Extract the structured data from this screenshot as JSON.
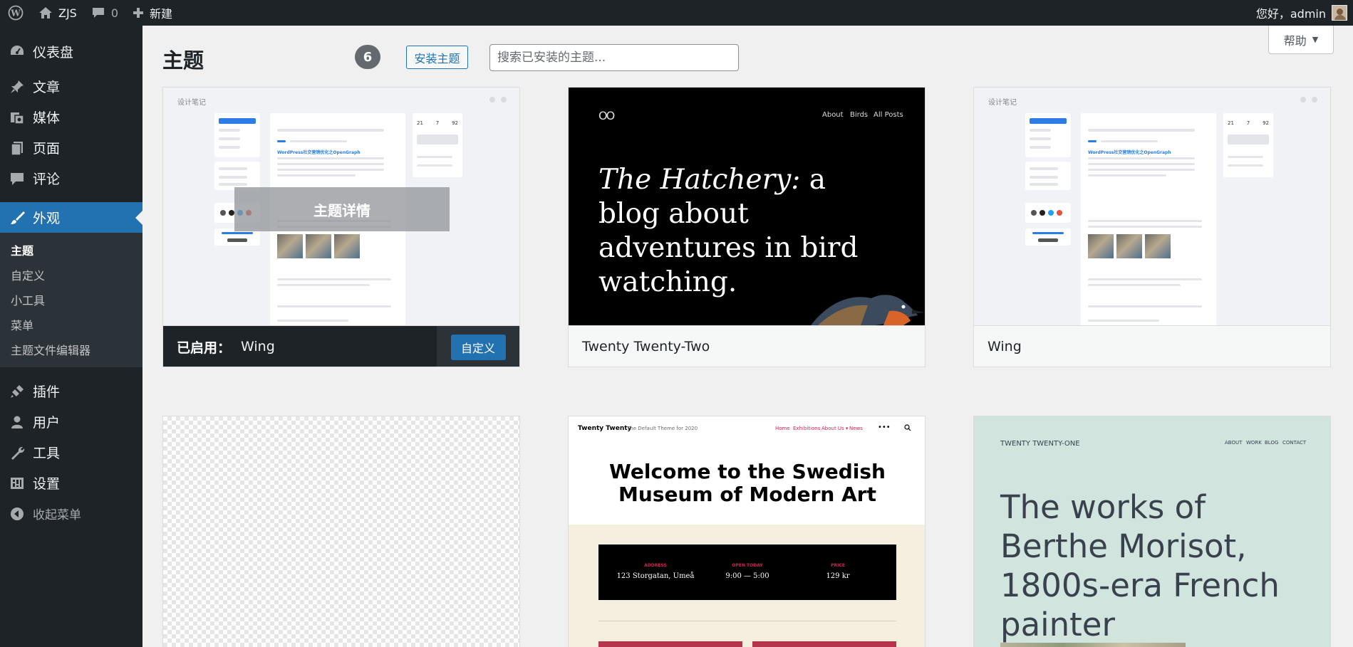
{
  "admin_bar": {
    "site_name": "ZJS",
    "comments_count": "0",
    "new_label": "新建",
    "greeting": "您好，admin"
  },
  "sidebar": {
    "items": [
      {
        "label": "仪表盘",
        "icon": "dashboard-icon"
      },
      {
        "label": "文章",
        "icon": "pin-icon"
      },
      {
        "label": "媒体",
        "icon": "media-icon"
      },
      {
        "label": "页面",
        "icon": "page-icon"
      },
      {
        "label": "评论",
        "icon": "comment-icon"
      },
      {
        "label": "外观",
        "icon": "paintbrush-icon"
      },
      {
        "label": "插件",
        "icon": "plugin-icon"
      },
      {
        "label": "用户",
        "icon": "user-icon"
      },
      {
        "label": "工具",
        "icon": "wrench-icon"
      },
      {
        "label": "设置",
        "icon": "settings-icon"
      }
    ],
    "submenu": [
      "主题",
      "自定义",
      "小工具",
      "菜单",
      "主题文件编辑器"
    ],
    "collapse_label": "收起菜单"
  },
  "main": {
    "title": "主题",
    "count": "6",
    "install_label": "安装主题",
    "search_placeholder": "搜索已安装的主题...",
    "help_label": "帮助"
  },
  "themes": {
    "active": {
      "active_label": "已启用：",
      "name": "Wing",
      "customize_label": "自定义",
      "details_overlay": "主题详情",
      "preview": {
        "site_name": "设计笔记",
        "post_title": "WordPress社交营销优化之OpenGraph",
        "stats": [
          "21",
          "7",
          "92"
        ]
      }
    },
    "tt2": {
      "name": "Twenty Twenty-Two",
      "preview": {
        "logo": "OO",
        "nav": [
          "About",
          "Birds",
          "All Posts"
        ],
        "heading_italic": "The Hatchery:",
        "heading_rest": " a blog about adventures in bird watching."
      }
    },
    "wing": {
      "name": "Wing",
      "preview": {
        "site_name": "设计笔记",
        "post_title": "WordPress社交营销优化之OpenGraph",
        "stats": [
          "21",
          "7",
          "92"
        ]
      }
    },
    "t20": {
      "preview": {
        "site_name": "Twenty Twenty",
        "tagline": "The Default Theme for 2020",
        "nav": [
          "Home",
          "Exhibitions",
          "About Us ▾",
          "News"
        ],
        "title": "Welcome to the Swedish Museum of Modern Art",
        "info": [
          {
            "label": "ADDRESS",
            "value": "123 Storgatan, Umeå"
          },
          {
            "label": "OPEN TODAY",
            "value": "9:00 — 5:00"
          },
          {
            "label": "PRICE",
            "value": "129 kr"
          }
        ]
      }
    },
    "t21": {
      "preview": {
        "site_name": "TWENTY TWENTY-ONE",
        "nav": [
          "ABOUT",
          "WORK",
          "BLOG",
          "CONTACT"
        ],
        "heading": "The works of Berthe Morisot, 1800s-era French painter"
      }
    }
  },
  "colors": {
    "admin_dark": "#1d2327",
    "accent_blue": "#2271b1",
    "t21_green": "#d1e4dd",
    "t20_red": "#cd2653"
  }
}
